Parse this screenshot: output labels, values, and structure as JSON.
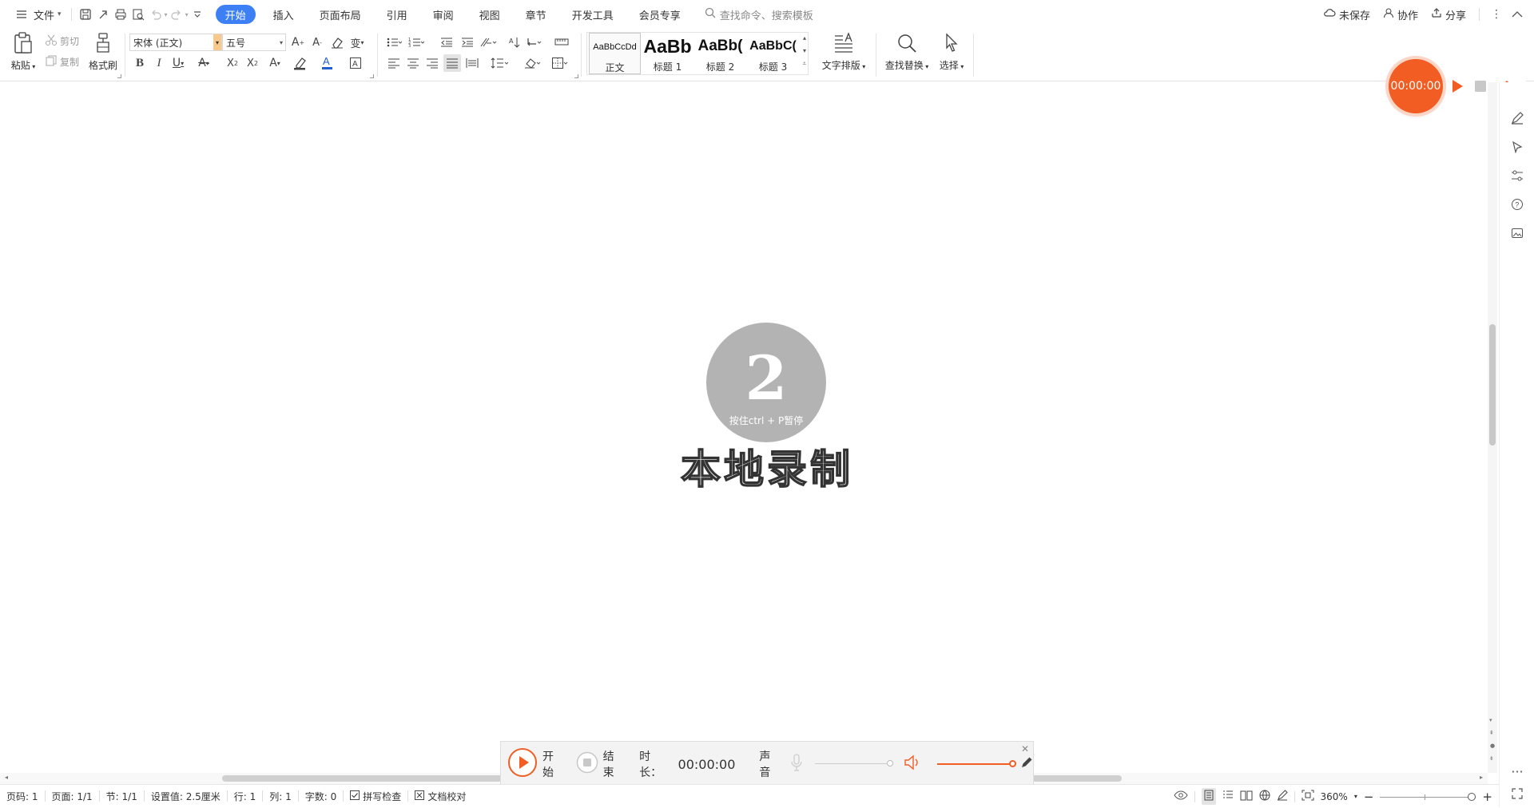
{
  "titlebar": {
    "file_label": "文件",
    "tabs": [
      "开始",
      "插入",
      "页面布局",
      "引用",
      "审阅",
      "视图",
      "章节",
      "开发工具",
      "会员专享"
    ],
    "active_tab": "开始",
    "search_placeholder": "查找命令、搜索模板",
    "unsaved_label": "未保存",
    "collab_label": "协作",
    "share_label": "分享"
  },
  "ribbon": {
    "paste_label": "粘贴",
    "cut_label": "剪切",
    "copy_label": "复制",
    "format_painter_label": "格式刷",
    "font_name": "宋体 (正文)",
    "font_size": "五号",
    "styles": [
      {
        "preview": "AaBbCcDd",
        "name": "正文"
      },
      {
        "preview": "AaBb",
        "name": "标题 1"
      },
      {
        "preview": "AaBb(",
        "name": "标题 2"
      },
      {
        "preview": "AaBbC(",
        "name": "标题 3"
      }
    ],
    "text_layout_label": "文字排版",
    "find_replace_label": "查找替换",
    "select_label": "选择"
  },
  "document": {
    "countdown_number": "2",
    "countdown_hint": "按住ctrl + P暂停",
    "record_title": "本地录制"
  },
  "recorder_float": {
    "timer": "00:00:00"
  },
  "recorder_bar": {
    "start_label": "开始",
    "stop_label": "结束",
    "duration_label": "时长：",
    "duration_value": "00:00:00",
    "sound_label": "声音"
  },
  "statusbar": {
    "page_code": "页码: 1",
    "page": "页面: 1/1",
    "section": "节: 1/1",
    "setting": "设置值: 2.5厘米",
    "row": "行: 1",
    "col": "列: 1",
    "word_count": "字数: 0",
    "spell_check": "拼写检查",
    "doc_proof": "文档校对",
    "zoom": "360%"
  },
  "colors": {
    "accent_blue": "#3d7ff5",
    "record_orange": "#f25d23"
  }
}
